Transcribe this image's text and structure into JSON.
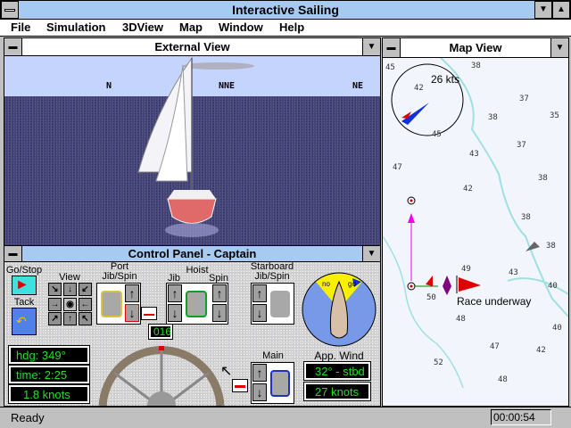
{
  "app": {
    "title": "Interactive Sailing"
  },
  "menu": [
    "File",
    "Simulation",
    "3DView",
    "Map",
    "Window",
    "Help"
  ],
  "external_view": {
    "title": "External View",
    "compass_labels": [
      "N",
      "NNE",
      "NE"
    ]
  },
  "control_panel": {
    "title": "Control Panel - Captain",
    "go_stop_label": "Go/Stop",
    "tack_label": "Tack",
    "view_label": "View",
    "port_label": "Port\nJib/Spin",
    "hoist_label": "Hoist",
    "jib_label": "Jib",
    "spin_label": "Spin",
    "starboard_label": "Starboard\nJib/Spin",
    "main_label": "Main",
    "rudder_value": "016",
    "heading": "hdg: 349°",
    "time": "time: 2:25",
    "speed": "1.8 knots",
    "app_wind_label": "App. Wind",
    "app_wind_angle": "32° - stbd",
    "app_wind_speed": "27 knots",
    "wind_no": "no",
    "wind_go": "go"
  },
  "map_view": {
    "title": "Map View",
    "wind_speed": "26 kts",
    "race_status": "Race underway",
    "depths": [
      {
        "v": "45"
      },
      {
        "v": "38"
      },
      {
        "v": "42"
      },
      {
        "v": "37"
      },
      {
        "v": "35"
      },
      {
        "v": "38"
      },
      {
        "v": "45"
      },
      {
        "v": "37"
      },
      {
        "v": "43"
      },
      {
        "v": "47"
      },
      {
        "v": "38"
      },
      {
        "v": "42"
      },
      {
        "v": "38"
      },
      {
        "v": "38"
      },
      {
        "v": "49"
      },
      {
        "v": "43"
      },
      {
        "v": "40"
      },
      {
        "v": "50"
      },
      {
        "v": "48"
      },
      {
        "v": "40"
      },
      {
        "v": "47"
      },
      {
        "v": "42"
      },
      {
        "v": "52"
      },
      {
        "v": "48"
      }
    ]
  },
  "status_bar": {
    "text": "Ready",
    "clock": "00:00:54"
  }
}
